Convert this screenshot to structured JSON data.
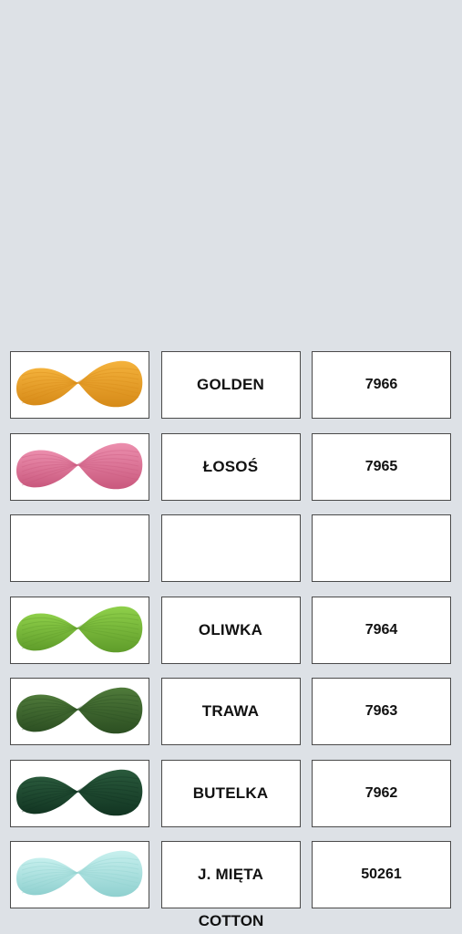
{
  "rows": [
    {
      "name": "GOLDEN",
      "code": "7966",
      "swatch_icon": "yarn-skein-icon",
      "color_light": "#f4b23c",
      "color_dark": "#d68a18"
    },
    {
      "name": "ŁOSOŚ",
      "code": "7965",
      "swatch_icon": "yarn-skein-icon",
      "color_light": "#ec8fae",
      "color_dark": "#c9587d"
    },
    {
      "name": "",
      "code": "",
      "swatch_icon": "",
      "color_light": "",
      "color_dark": ""
    },
    {
      "name": "OLIWKA",
      "code": "7964",
      "swatch_icon": "yarn-skein-icon",
      "color_light": "#8fd04a",
      "color_dark": "#5f9c2a"
    },
    {
      "name": "TRAWA",
      "code": "7963",
      "swatch_icon": "yarn-skein-icon",
      "color_light": "#4f7a3a",
      "color_dark": "#2c4f22"
    },
    {
      "name": "BUTELKA",
      "code": "7962",
      "swatch_icon": "yarn-skein-icon",
      "color_light": "#2a5a3c",
      "color_dark": "#123522"
    },
    {
      "name": "J. MIĘTA",
      "code": "50261",
      "swatch_icon": "yarn-skein-icon",
      "color_light": "#c7f0ee",
      "color_dark": "#8fd0cf"
    }
  ],
  "footer": {
    "label": "COTTON"
  }
}
